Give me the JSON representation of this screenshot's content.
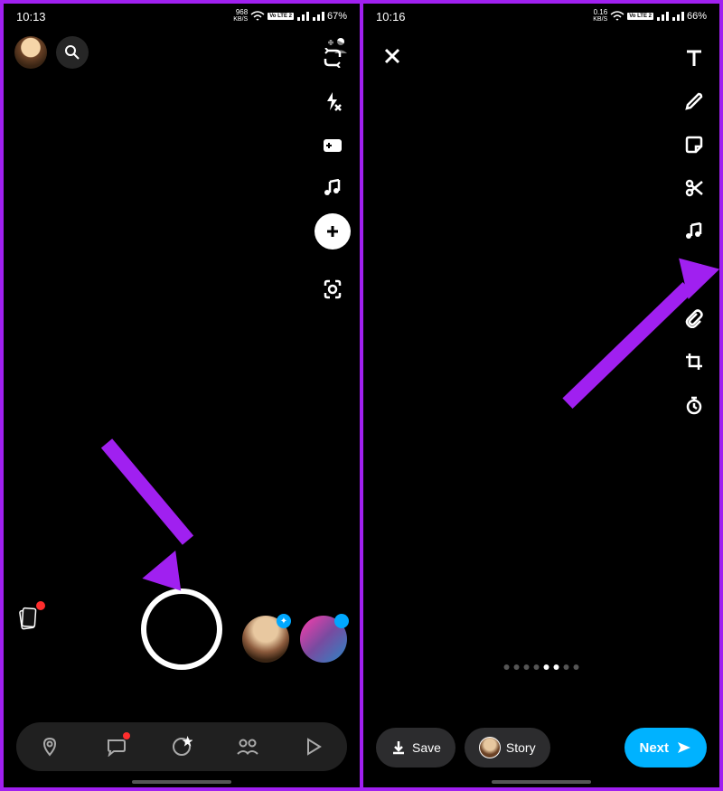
{
  "left": {
    "status": {
      "time": "10:13",
      "data_rate": "968",
      "data_unit": "KB/S",
      "lte": "Vo LTE 2",
      "battery": "67%"
    },
    "sidebar": {
      "flip": "flip-camera-icon",
      "flash": "flash-off-icon",
      "video_add": "add-clip-icon",
      "music": "music-icon",
      "plus": "add-tool-icon",
      "scan": "scan-icon"
    },
    "nav": {
      "map": "map-icon",
      "chat": "chat-icon",
      "spotlight": "spotlight-icon",
      "friends": "friends-icon",
      "play": "play-icon"
    }
  },
  "right": {
    "status": {
      "time": "10:16",
      "data_rate": "0.16",
      "data_unit": "KB/S",
      "lte": "Vo LTE 2",
      "battery": "66%"
    },
    "tools": {
      "text": "text-icon",
      "draw": "pencil-icon",
      "sticker": "sticker-icon",
      "scissors": "scissors-icon",
      "music": "music-icon",
      "effect": "sparkle-icon",
      "attach": "paperclip-icon",
      "crop": "crop-icon",
      "timer": "timer-icon"
    },
    "actions": {
      "save": "Save",
      "story": "Story",
      "next": "Next"
    }
  }
}
